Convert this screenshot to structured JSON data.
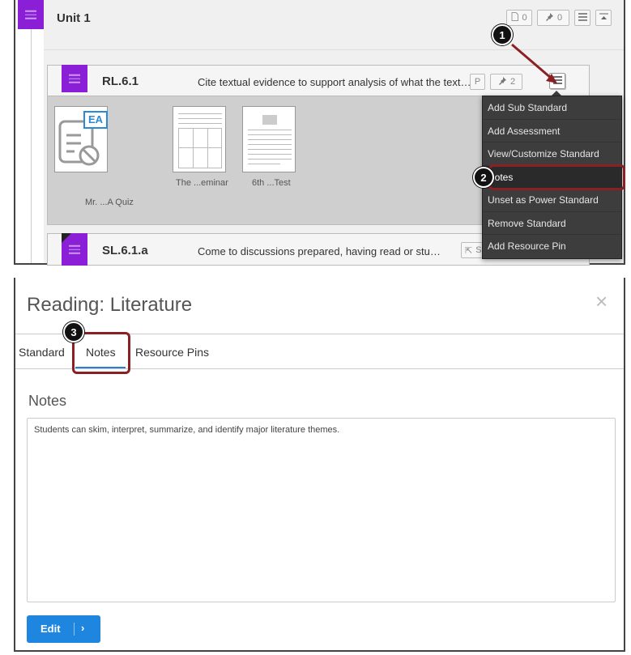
{
  "unit": {
    "title": "Unit 1",
    "assessment_count": "0",
    "pin_count": "0"
  },
  "standard": {
    "code": "RL.6.1",
    "description": "Cite textual evidence to support analysis of what the text…",
    "power_badge": "P",
    "pin_count": "2",
    "resources": [
      {
        "label": "Mr. ...A Quiz",
        "badge": "EA"
      },
      {
        "label": "The ...eminar"
      },
      {
        "label": "6th ...Test"
      }
    ]
  },
  "standard2": {
    "code": "SL.6.1.a",
    "description": "Come to discussions prepared, having read or stu…",
    "link_label": "SL.6"
  },
  "menu": {
    "items": [
      "Add Sub Standard",
      "Add Assessment",
      "View/Customize Standard",
      "Notes",
      "Unset as Power Standard",
      "Remove Standard",
      "Add Resource Pin"
    ]
  },
  "callouts": [
    "1",
    "2",
    "3"
  ],
  "modal": {
    "title": "Reading: Literature",
    "close_symbol": "×",
    "tabs": [
      "Standard",
      "Notes",
      "Resource Pins"
    ],
    "active_tab": "Notes",
    "section_title": "Notes",
    "notes_text": "Students can skim, interpret, summarize, and identify major literature themes.",
    "edit_label": "Edit",
    "edit_chevron": "›"
  },
  "colors": {
    "handle": "#8b1fd8",
    "highlight": "#8a1f24",
    "primary_button": "#1f86e0",
    "menu_bg": "#3d3d3d"
  }
}
